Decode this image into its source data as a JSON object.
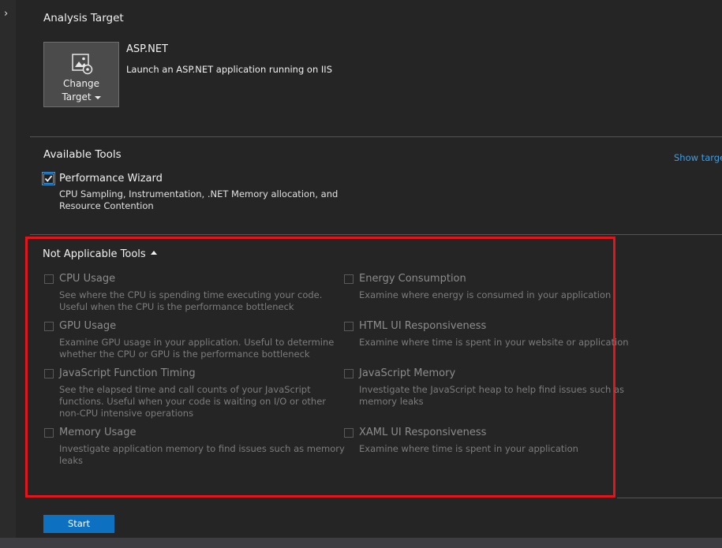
{
  "analysis_target": {
    "section_title": "Analysis Target",
    "change_target_label": [
      "Change",
      "Target"
    ],
    "target_name": "ASP.NET",
    "target_description": "Launch an ASP.NET application running on IIS",
    "icon": "target-settings-icon"
  },
  "available_tools": {
    "section_title": "Available Tools",
    "show_target_link": "Show target",
    "tool": {
      "name": "Performance Wizard",
      "checked": true,
      "description_lines": [
        "CPU Sampling, Instrumentation, .NET Memory allocation, and",
        "Resource Contention"
      ]
    }
  },
  "not_applicable": {
    "title": "Not Applicable Tools",
    "tools": [
      {
        "name": "CPU Usage",
        "desc": [
          "See where the CPU is spending time executing your code.",
          "Useful when the CPU is the performance bottleneck"
        ]
      },
      {
        "name": "Energy Consumption",
        "desc": [
          "Examine where energy is consumed in your application"
        ]
      },
      {
        "name": "GPU Usage",
        "desc": [
          "Examine GPU usage in your application. Useful to determine",
          "whether the CPU or GPU is the performance bottleneck"
        ]
      },
      {
        "name": "HTML UI Responsiveness",
        "desc": [
          "Examine where time is spent in your website or application"
        ]
      },
      {
        "name": "JavaScript Function Timing",
        "desc": [
          "See the elapsed time and call counts of your JavaScript",
          "functions. Useful when your code is waiting on I/O or other",
          "non-CPU intensive operations"
        ]
      },
      {
        "name": "JavaScript Memory",
        "desc": [
          "Investigate the JavaScript heap to help find issues such as",
          "memory leaks"
        ]
      },
      {
        "name": "Memory Usage",
        "desc": [
          "Investigate application memory to find issues such as memory",
          "leaks"
        ]
      },
      {
        "name": "XAML UI Responsiveness",
        "desc": [
          "Examine where time is spent in your application"
        ]
      }
    ]
  },
  "start_label": "Start",
  "colors": {
    "accent": "#0e70c0",
    "link": "#3b9fe6",
    "highlight_box": "#e2141c",
    "background": "#252526"
  }
}
